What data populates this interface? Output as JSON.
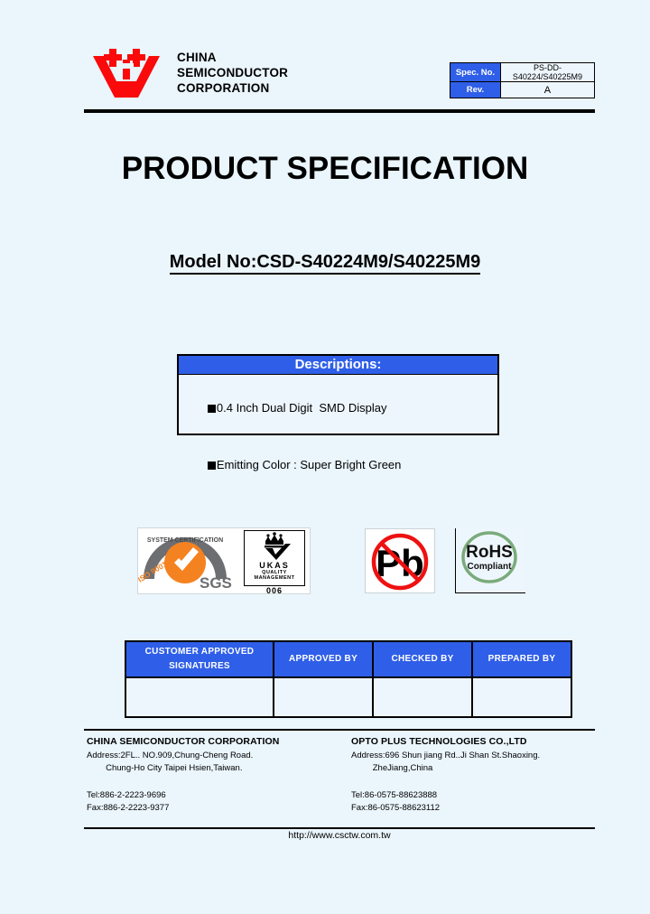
{
  "header": {
    "company_line1": "CHINA",
    "company_line2": "SEMICONDUCTOR",
    "company_line3": "CORPORATION",
    "logo_name": "china-semiconductor-logo",
    "spec_label": "Spec. No.",
    "spec_value": "PS-DD-S40224/S40225M9",
    "rev_label": "Rev.",
    "rev_value": "A"
  },
  "title": {
    "main": "PRODUCT SPECIFICATION",
    "model": "Model No:CSD-S40224M9/S40225M9"
  },
  "descriptions": {
    "heading": "Descriptions:",
    "items": [
      "0.4 Inch Dual Digit  SMD Display",
      "Emitting Color : Super Bright Green"
    ]
  },
  "certifications": {
    "sgs": {
      "iso_text": "ISO 9001:2000",
      "arc_text": "SYSTEM CERTIFICATION",
      "brand": "SGS"
    },
    "ukas": {
      "name": "UKAS",
      "sub_line1": "QUALITY",
      "sub_line2": "MANAGEMENT",
      "number": "006"
    },
    "pb": {
      "label": "Pb"
    },
    "rohs": {
      "line1": "RoHS",
      "line2": "Compliant"
    }
  },
  "signature_table": {
    "headers": [
      "CUSTOMER APPROVED\nSIGNATURES",
      "APPROVED BY",
      "CHECKED BY",
      "PREPARED BY"
    ],
    "header_0_line1": "CUSTOMER APPROVED",
    "header_0_line2": "SIGNATURES",
    "header_1": "APPROVED BY",
    "header_2": "CHECKED BY",
    "header_3": "PREPARED BY",
    "values": [
      "",
      "",
      "",
      ""
    ]
  },
  "footer": {
    "left": {
      "company": "CHINA SEMICONDUCTOR CORPORATION",
      "address_line1": "Address:2FL.. NO.909,Chung-Cheng Road.",
      "address_line2": "        Chung-Ho City Taipei Hsien,Taiwan.",
      "tel": "Tel:886-2-2223-9696",
      "fax": "Fax:886-2-2223-9377"
    },
    "right": {
      "company": "OPTO PLUS TECHNOLOGIES CO.,LTD",
      "address_line1": "Address:696 Shun jiang Rd..Ji Shan St.Shaoxing.",
      "address_line2": "         ZheJiang,China",
      "tel": "Tel:86-0575-88623888",
      "fax": "Fax:86-0575-88623112"
    },
    "website": "http://www.csctw.com.tw"
  },
  "colors": {
    "page_background": "#eaf5fc",
    "accent_blue": "#2f5fe8",
    "logo_red": "#fa0a0a",
    "rohs_green": "#7aab7a",
    "pb_red": "#ee1111",
    "sgs_orange": "#f58220",
    "sgs_gray": "#6d6e71"
  }
}
